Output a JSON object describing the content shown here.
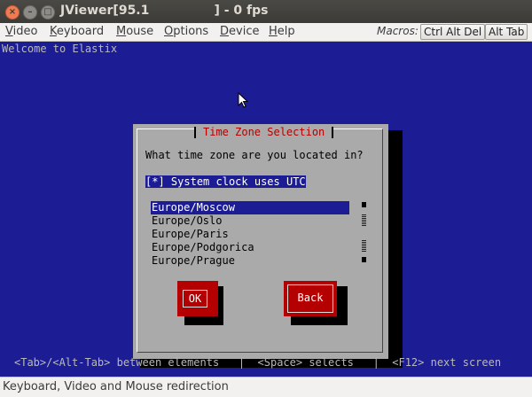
{
  "window": {
    "title": "JViewer[95.1               ] - 0 fps"
  },
  "menubar": {
    "items": [
      {
        "first": "V",
        "rest": "ideo"
      },
      {
        "first": "K",
        "rest": "eyboard"
      },
      {
        "first": "M",
        "rest": "ouse"
      },
      {
        "first": "O",
        "rest": "ptions"
      },
      {
        "first": "D",
        "rest": "evice"
      },
      {
        "first": "H",
        "rest": "elp"
      }
    ],
    "macros_label": "Macros:",
    "macro_buttons": [
      "Ctrl Alt Del",
      "Alt Tab"
    ]
  },
  "console": {
    "welcome": "Welcome to Elastix",
    "dialog": {
      "title": "Time Zone Selection",
      "question": "What time zone are you located in?",
      "checkbox_mark": "[*]",
      "checkbox_label": "System clock uses UTC",
      "timezones": [
        "Europe/Moscow",
        "Europe/Oslo",
        "Europe/Paris",
        "Europe/Podgorica",
        "Europe/Prague"
      ],
      "selected_index": 0,
      "ok_label": "OK",
      "back_label": "Back"
    },
    "hint": "<Tab>/<Alt-Tab> between elements   |  <Space> selects   |  <F12> next screen"
  },
  "statusbar": {
    "text": "Keyboard, Video and Mouse redirection"
  }
}
